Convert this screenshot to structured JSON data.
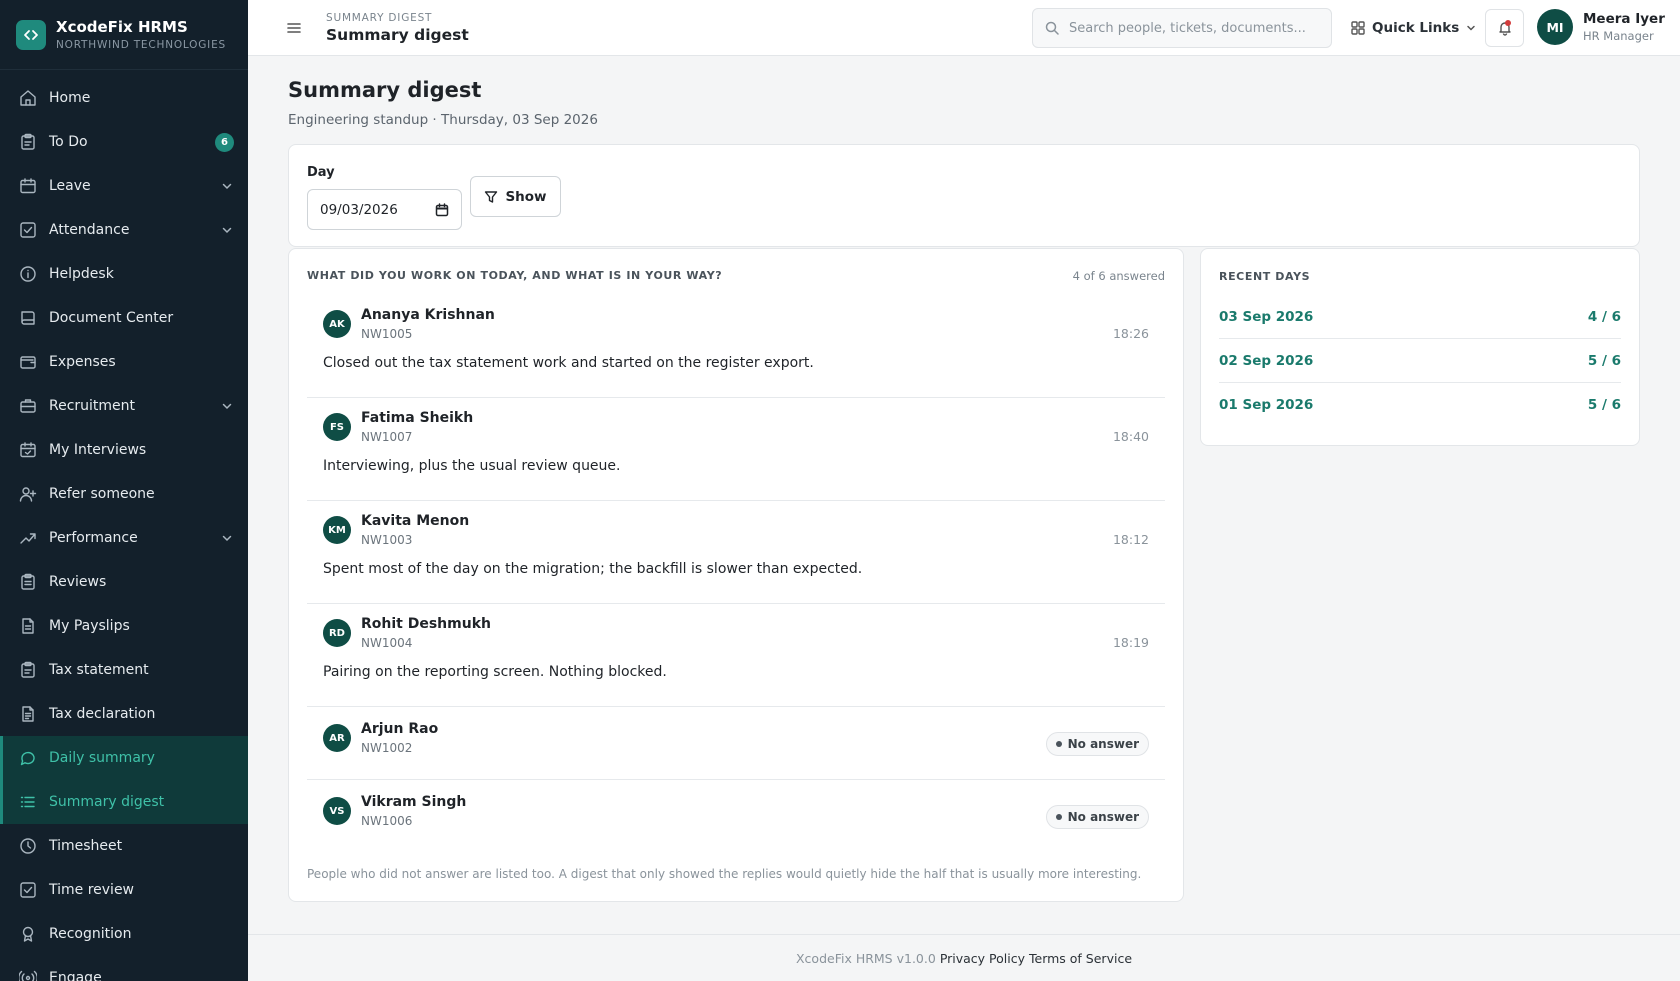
{
  "app": {
    "name": "XcodeFix HRMS",
    "org": "NORTHWIND TECHNOLOGIES",
    "accent": "#1f8a7d"
  },
  "sidebar": {
    "items": [
      {
        "label": "Home",
        "icon": "home-icon"
      },
      {
        "label": "To Do",
        "icon": "clipboard-icon",
        "badge": "6"
      },
      {
        "label": "Leave",
        "icon": "calendar-icon",
        "expandable": true
      },
      {
        "label": "Attendance",
        "icon": "check-square-icon",
        "expandable": true
      },
      {
        "label": "Helpdesk",
        "icon": "info-icon"
      },
      {
        "label": "Document Center",
        "icon": "book-icon"
      },
      {
        "label": "Expenses",
        "icon": "wallet-icon"
      },
      {
        "label": "Recruitment",
        "icon": "briefcase-icon",
        "expandable": true
      },
      {
        "label": "My Interviews",
        "icon": "calendar-check-icon"
      },
      {
        "label": "Refer someone",
        "icon": "user-plus-icon"
      },
      {
        "label": "Performance",
        "icon": "trend-up-icon",
        "expandable": true
      },
      {
        "label": "Reviews",
        "icon": "clipboard-list-icon"
      },
      {
        "label": "My Payslips",
        "icon": "file-icon"
      },
      {
        "label": "Tax statement",
        "icon": "clipboard-icon"
      },
      {
        "label": "Tax declaration",
        "icon": "file-text-icon"
      },
      {
        "label": "Daily summary",
        "icon": "chat-bubble-icon",
        "active": true
      },
      {
        "label": "Summary digest",
        "icon": "list-icon",
        "active": true
      },
      {
        "label": "Timesheet",
        "icon": "clock-icon"
      },
      {
        "label": "Time review",
        "icon": "check-square-icon"
      },
      {
        "label": "Recognition",
        "icon": "award-icon"
      },
      {
        "label": "Engage",
        "icon": "broadcast-icon"
      }
    ]
  },
  "topbar": {
    "breadcrumb": "SUMMARY DIGEST",
    "title": "Summary digest",
    "search_placeholder": "Search people, tickets, documents...",
    "quick_links": "Quick Links",
    "user": {
      "initials": "MI",
      "name": "Meera Iyer",
      "role": "HR Manager"
    }
  },
  "page": {
    "title": "Summary digest",
    "subtitle": "Engineering standup · Thursday, 03 Sep 2026"
  },
  "filter": {
    "day_label": "Day",
    "day_value": "09/03/2026",
    "show_label": "Show"
  },
  "answers": {
    "question": "WHAT DID YOU WORK ON TODAY, AND WHAT IS IN YOUR WAY?",
    "count": "4 of 6 answered",
    "entries": [
      {
        "initials": "AK",
        "name": "Ananya Krishnan",
        "id": "NW1005",
        "time": "18:26",
        "text": "Closed out the tax statement work and started on the register export."
      },
      {
        "initials": "FS",
        "name": "Fatima Sheikh",
        "id": "NW1007",
        "time": "18:40",
        "text": "Interviewing, plus the usual review queue."
      },
      {
        "initials": "KM",
        "name": "Kavita Menon",
        "id": "NW1003",
        "time": "18:12",
        "text": "Spent most of the day on the migration; the backfill is slower than expected."
      },
      {
        "initials": "RD",
        "name": "Rohit Deshmukh",
        "id": "NW1004",
        "time": "18:19",
        "text": "Pairing on the reporting screen. Nothing blocked."
      }
    ],
    "no_answer": [
      {
        "initials": "AR",
        "name": "Arjun Rao",
        "id": "NW1002",
        "status": "No answer"
      },
      {
        "initials": "VS",
        "name": "Vikram Singh",
        "id": "NW1006",
        "status": "No answer"
      }
    ],
    "footnote": "People who did not answer are listed too. A digest that only showed the replies would quietly hide the half that is usually more interesting."
  },
  "recent": {
    "title": "RECENT DAYS",
    "days": [
      {
        "date": "03 Sep 2026",
        "ratio": "4 / 6"
      },
      {
        "date": "02 Sep 2026",
        "ratio": "5 / 6"
      },
      {
        "date": "01 Sep 2026",
        "ratio": "5 / 6"
      }
    ]
  },
  "footer": {
    "version": "XcodeFix HRMS v1.0.0",
    "privacy": "Privacy Policy",
    "terms": "Terms of Service"
  }
}
